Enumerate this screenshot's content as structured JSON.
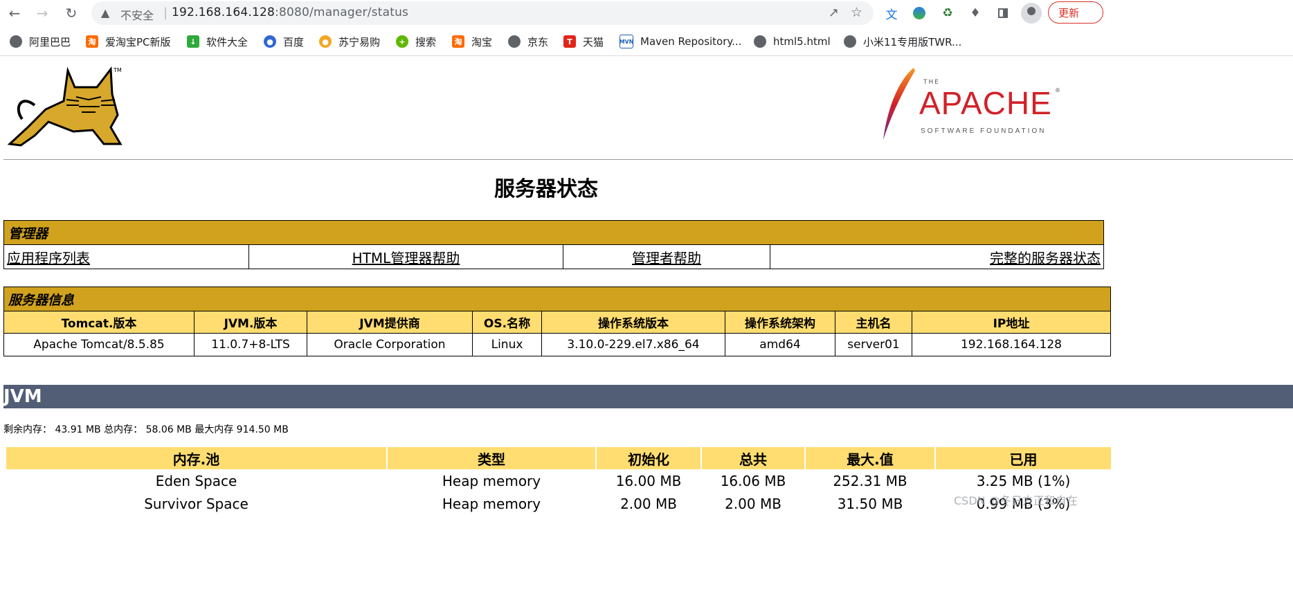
{
  "browser": {
    "insecure_label": "不安全",
    "url_host": "192.168.164.128",
    "url_rest": ":8080/manager/status",
    "update_label": "更新"
  },
  "bookmarks": [
    {
      "label": "阿里巴巴",
      "icon": "globe-icon"
    },
    {
      "label": "爱淘宝PC新版",
      "icon": "taobao-icon"
    },
    {
      "label": "软件大全",
      "icon": "download-icon"
    },
    {
      "label": "百度",
      "icon": "baidu-icon"
    },
    {
      "label": "苏宁易购",
      "icon": "suning-icon"
    },
    {
      "label": "搜索",
      "icon": "search-plus-icon"
    },
    {
      "label": "淘宝",
      "icon": "taobao-icon"
    },
    {
      "label": "京东",
      "icon": "globe-icon"
    },
    {
      "label": "天猫",
      "icon": "tmall-icon"
    },
    {
      "label": "Maven Repository...",
      "icon": "mvn-icon"
    },
    {
      "label": "html5.html",
      "icon": "globe-icon"
    },
    {
      "label": "小米11专用版TWR...",
      "icon": "globe-icon"
    }
  ],
  "page": {
    "title": "服务器状态",
    "apache": {
      "the": "THE",
      "name": "APACHE",
      "sub": "SOFTWARE FOUNDATION"
    },
    "manager": {
      "heading": "管理器",
      "links": [
        "应用程序列表",
        "HTML管理器帮助",
        "管理者帮助",
        "完整的服务器状态"
      ]
    },
    "server_info": {
      "heading": "服务器信息",
      "columns": [
        "Tomcat.版本",
        "JVM.版本",
        "JVM提供商",
        "OS.名称",
        "操作系统版本",
        "操作系统架构",
        "主机名",
        "IP地址"
      ],
      "values": [
        "Apache Tomcat/8.5.85",
        "11.0.7+8-LTS",
        "Oracle Corporation",
        "Linux",
        "3.10.0-229.el7.x86_64",
        "amd64",
        "server01",
        "192.168.164.128"
      ]
    },
    "jvm": {
      "heading": "JVM",
      "memory_line": "剩余内存： 43.91 MB 总内存： 58.06 MB 最大内存 914.50 MB",
      "columns": [
        "内存.池",
        "类型",
        "初始化",
        "总共",
        "最大.值",
        "已用"
      ],
      "rows": [
        [
          "Eden Space",
          "Heap memory",
          "16.00 MB",
          "16.06 MB",
          "252.31 MB",
          "3.25 MB (1%)"
        ],
        [
          "Survivor Space",
          "Heap memory",
          "2.00 MB",
          "2.00 MB",
          "31.50 MB",
          "0.99 MB (3%)"
        ]
      ]
    },
    "watermark": "CSDN @冬日方正和自在"
  }
}
